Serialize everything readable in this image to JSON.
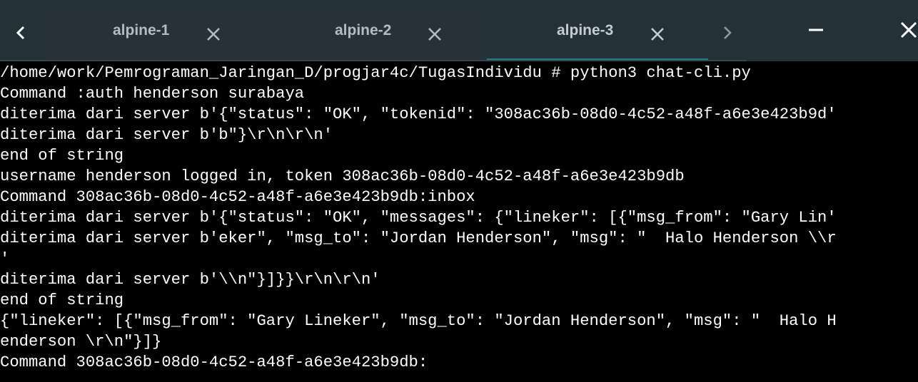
{
  "tabs": [
    {
      "title": "alpine-1",
      "active": false
    },
    {
      "title": "alpine-2",
      "active": false
    },
    {
      "title": "alpine-3",
      "active": true
    }
  ],
  "colors": {
    "tabbar_bg": "#253139",
    "tab_text": "#b3bcc0",
    "active_underline": "#1a7f84",
    "terminal_bg": "#000000",
    "terminal_fg": "#ffffff"
  },
  "icons": {
    "scroll_left": "chevron-left-icon",
    "scroll_right": "chevron-right-icon",
    "tab_close": "close-icon",
    "minimize": "minimize-icon",
    "close_window": "close-icon"
  },
  "terminal": {
    "lines": [
      "/home/work/Pemrograman_Jaringan_D/progjar4c/TugasIndividu # python3 chat-cli.py",
      "Command :auth henderson surabaya",
      "diterima dari server b'{\"status\": \"OK\", \"tokenid\": \"308ac36b-08d0-4c52-a48f-a6e3e423b9d'",
      "diterima dari server b'b\"}\\r\\n\\r\\n'",
      "end of string",
      "username henderson logged in, token 308ac36b-08d0-4c52-a48f-a6e3e423b9db",
      "Command 308ac36b-08d0-4c52-a48f-a6e3e423b9db:inbox",
      "diterima dari server b'{\"status\": \"OK\", \"messages\": {\"lineker\": [{\"msg_from\": \"Gary Lin'",
      "diterima dari server b'eker\", \"msg_to\": \"Jordan Henderson\", \"msg\": \"  Halo Henderson \\\\r",
      "'",
      "diterima dari server b'\\\\n\"}]}}\\r\\n\\r\\n'",
      "end of string",
      "{\"lineker\": [{\"msg_from\": \"Gary Lineker\", \"msg_to\": \"Jordan Henderson\", \"msg\": \"  Halo H",
      "enderson \\r\\n\"}]}",
      "Command 308ac36b-08d0-4c52-a48f-a6e3e423b9db:"
    ]
  }
}
